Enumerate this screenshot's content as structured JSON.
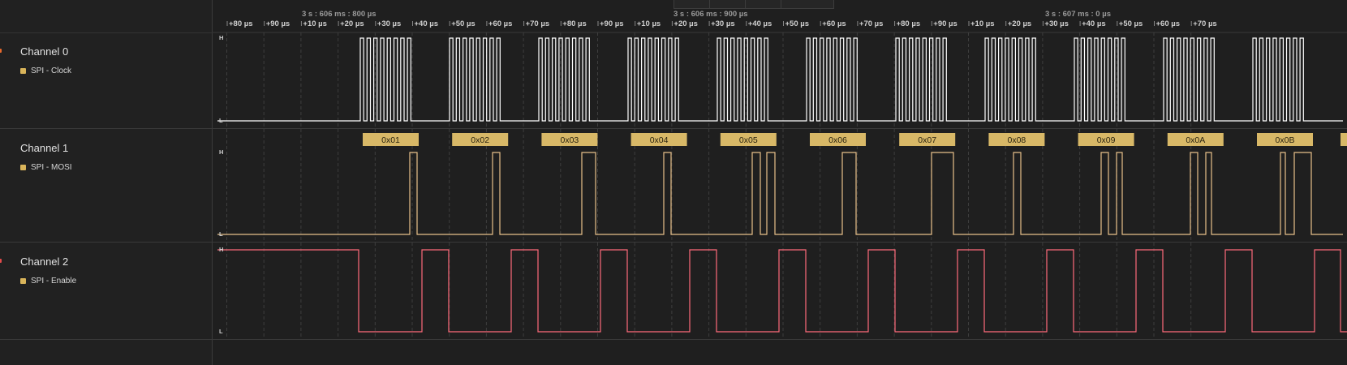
{
  "timeline": {
    "time_labels": [
      "3 s : 606 ms : 800 µs",
      "3 s : 606 ms : 900 µs",
      "3 s : 607 ms : 0 µs"
    ],
    "ticks": [
      "+80 µs",
      "+90 µs",
      "+10 µs",
      "+20 µs",
      "+30 µs",
      "+40 µs",
      "+50 µs",
      "+60 µs",
      "+70 µs",
      "+80 µs",
      "+90 µs",
      "+10 µs",
      "+20 µs",
      "+30 µs",
      "+40 µs",
      "+50 µs",
      "+60 µs",
      "+70 µs",
      "+80 µs",
      "+90 µs",
      "+10 µs",
      "+20 µs",
      "+30 µs",
      "+40 µs",
      "+50 µs",
      "+60 µs",
      "+70 µs"
    ]
  },
  "channels": [
    {
      "name": "Channel 0",
      "analyzer": "SPI - Clock",
      "dot_color": "#d9b45a",
      "marker_color": "#e8692c",
      "wave_color": "#ffffff",
      "high_label": "H",
      "low_label": "L"
    },
    {
      "name": "Channel 1",
      "analyzer": "SPI - MOSI",
      "dot_color": "#d9b45a",
      "marker_color": "",
      "wave_color": "#e8c08a",
      "high_label": "H",
      "low_label": "L"
    },
    {
      "name": "Channel 2",
      "analyzer": "SPI - Enable",
      "dot_color": "#d9b45a",
      "marker_color": "#e34b4b",
      "wave_color": "#ff6b7b",
      "high_label": "H",
      "low_label": "L"
    }
  ],
  "decoded_bytes": [
    "0x01",
    "0x02",
    "0x03",
    "0x04",
    "0x05",
    "0x06",
    "0x07",
    "0x08",
    "0x09",
    "0x0A",
    "0x0B"
  ],
  "decode_color": "#d8b867"
}
